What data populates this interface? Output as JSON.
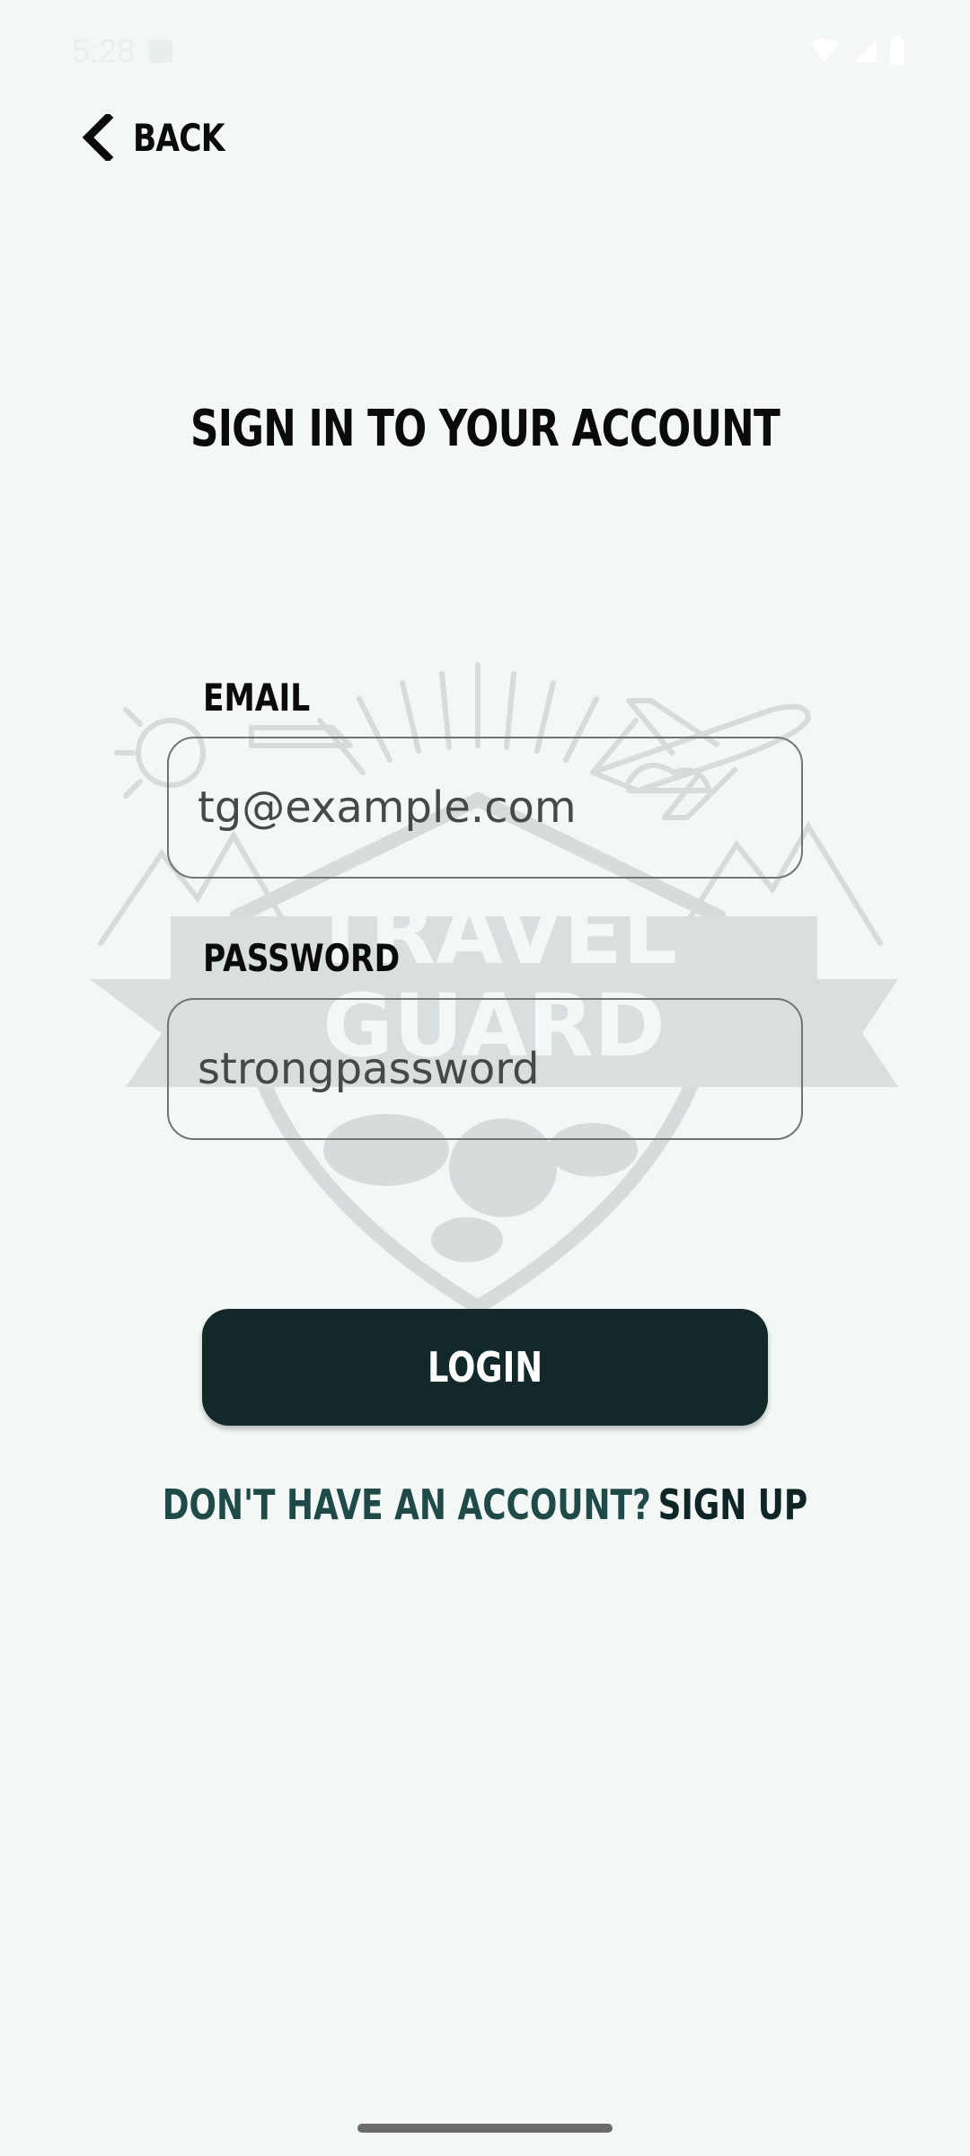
{
  "status_bar": {
    "time": "5:28"
  },
  "nav": {
    "back_label": "BACK"
  },
  "page": {
    "title": "SIGN IN TO YOUR ACCOUNT"
  },
  "watermark": {
    "line1": "TRAVEL",
    "line2": "GUARD"
  },
  "form": {
    "email_label": "EMAIL",
    "email_value": "tg@example.com",
    "password_label": "PASSWORD",
    "password_value": "strongpassword"
  },
  "actions": {
    "login_label": "LOGIN",
    "signup_prompt": "DON'T HAVE AN ACCOUNT?",
    "signup_link": "SIGN UP"
  },
  "colors": {
    "background": "#f3f8f7",
    "button": "#132828",
    "prompt_text": "#1f4a47"
  }
}
